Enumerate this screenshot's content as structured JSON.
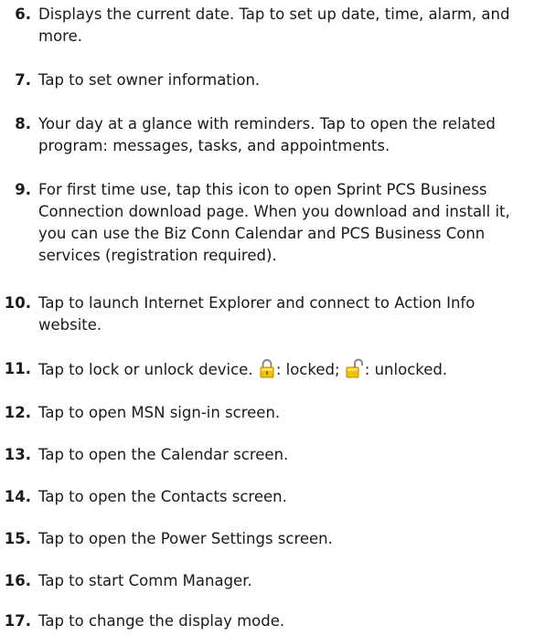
{
  "items": [
    {
      "number": "6.",
      "text": "Displays the current date. Tap to set up date, time, alarm, and more."
    },
    {
      "number": "7.",
      "text": "Tap to set owner information."
    },
    {
      "number": "8.",
      "text": "Your day at a glance with reminders. Tap to open the related program: messages, tasks, and appointments."
    },
    {
      "number": "9.",
      "text": "For first time use, tap this icon to open Sprint PCS Business Connection download page. When you download and install it, you can use the Biz Conn Calendar and PCS Business Conn services (registration required)."
    },
    {
      "number": "10.",
      "text": "Tap to launch Internet Explorer and connect to Action Info website."
    },
    {
      "number": "11.",
      "text_before": "Tap to lock or unlock device.",
      "locked_label": ": locked;",
      "unlocked_label": ": unlocked."
    },
    {
      "number": "12.",
      "text": "Tap to open MSN sign-in screen."
    },
    {
      "number": "13.",
      "text": "Tap to open the Calendar screen."
    },
    {
      "number": "14.",
      "text": "Tap to open the Contacts screen."
    },
    {
      "number": "15.",
      "text": "Tap to open the Power Settings screen."
    },
    {
      "number": "16.",
      "text": "Tap to start Comm Manager."
    },
    {
      "number": "17.",
      "text": "Tap to change the display mode."
    }
  ],
  "icons": {
    "locked": "padlock-locked-icon",
    "unlocked": "padlock-unlocked-icon",
    "icon_color": "#f2c200"
  }
}
